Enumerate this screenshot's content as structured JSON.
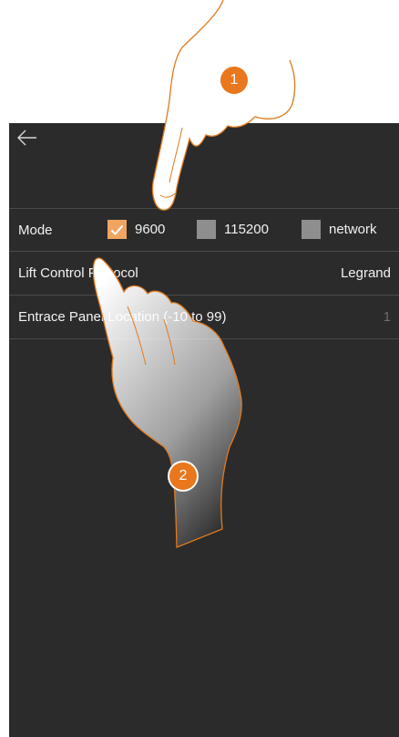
{
  "header": {
    "back_icon": "arrow-left-icon"
  },
  "settings": {
    "mode": {
      "label": "Mode",
      "options": [
        {
          "label": "9600",
          "checked": true
        },
        {
          "label": "115200",
          "checked": false
        },
        {
          "label": "network",
          "checked": false
        }
      ]
    },
    "lift_control": {
      "label": "Lift Control Protocol",
      "value": "Legrand"
    },
    "entrance_panel": {
      "label": "Entrace Panel Location (-10 to 99)",
      "value": "1"
    }
  },
  "annotations": {
    "step1": "1",
    "step2": "2"
  },
  "colors": {
    "accent": "#e9771d",
    "checkbox_checked": "#f0a561",
    "background": "#2b2b2b"
  }
}
